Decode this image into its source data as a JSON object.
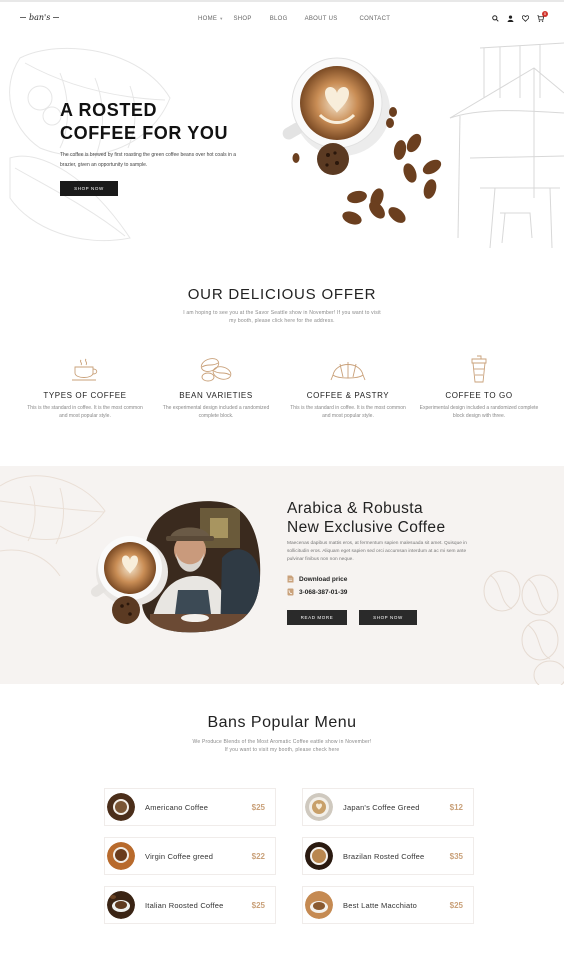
{
  "header": {
    "logo": "ban's",
    "nav": [
      {
        "label": "HOME",
        "has_dropdown": true
      },
      {
        "label": "SHOP",
        "has_dropdown": false
      },
      {
        "label": "BLOG",
        "has_dropdown": false
      },
      {
        "label": "ABOUT US",
        "has_dropdown": false
      },
      {
        "label": "CONTACT",
        "has_dropdown": false
      }
    ],
    "icons": [
      "search-icon",
      "user-icon",
      "heart-icon",
      "cart-icon"
    ],
    "cart_count": "0"
  },
  "hero": {
    "title_line1": "A ROSTED",
    "title_line2": "COFFEE FOR YOU",
    "text": "The coffee is brewed by first roasting the green coffee beans over hot coals in a brazier, given an opportunity to sample.",
    "button": "SHOP NOW"
  },
  "offer": {
    "title": "OUR DELICIOUS OFFER",
    "subtitle": "I am hoping to see you at the Savor Seattle show in November! If you want to visit my booth, please click here for the address.",
    "items": [
      {
        "title": "TYPES OF COFFEE",
        "desc": "This is the standard in coffee. It is the most common and most popular style.",
        "icon": "coffee-cup-icon"
      },
      {
        "title": "BEAN VARIETIES",
        "desc": "The experimental design included a randomized complete block.",
        "icon": "coffee-beans-icon"
      },
      {
        "title": "COFFEE & PASTRY",
        "desc": "This is the standard in coffee. It is the most common and most popular style.",
        "icon": "croissant-icon"
      },
      {
        "title": "COFFEE TO GO",
        "desc": "Experimental design included a randomized complete block design with three.",
        "icon": "takeaway-cup-icon"
      }
    ]
  },
  "arabica": {
    "title_line1": "Arabica & Robusta",
    "title_line2": "New Exclusive Coffee",
    "text": "Maecenas dapibus mattis eros, at fermentum sapien malesuada sit amet. Quisque in sollicitudin eros. Aliquam eget sapien sed orci accumsan interdum at ac mi sem ante pulvinar finibus non non neque.",
    "download_label": "Download price",
    "phone": "3-068-387-01-39",
    "button_read": "READ MORE",
    "button_shop": "SHOP NOW"
  },
  "menu": {
    "title": "Bans Popular Menu",
    "subtitle_line1": "We Produce Blends of the Most Aromatic Coffee eattle show in November!",
    "subtitle_line2": "If you want to visit my booth, please check here",
    "items": [
      {
        "name": "Americano Coffee",
        "price": "$25"
      },
      {
        "name": "Japan's Coffee Greed",
        "price": "$12"
      },
      {
        "name": "Virgin Coffee greed",
        "price": "$22"
      },
      {
        "name": "Brazilan Rosted Coffee",
        "price": "$35"
      },
      {
        "name": "Italian Roosted Coffee",
        "price": "$25"
      },
      {
        "name": "Best Latte Macchiato",
        "price": "$25"
      }
    ]
  },
  "colors": {
    "accent": "#c9a17a",
    "dark": "#1a1a1a",
    "band_bg": "#f6f3f1",
    "badge": "#d0342c"
  }
}
